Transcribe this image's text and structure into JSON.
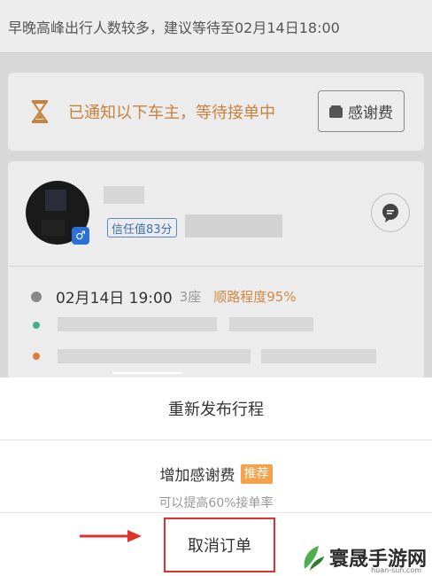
{
  "top_notice": {
    "text": "早晚高峰出行人数较多，建议等待至02月14日18:00"
  },
  "status_card": {
    "icon": "hourglass-icon",
    "text": "已通知以下车主，等待接单中",
    "thanks_button": "感谢费"
  },
  "driver": {
    "trust_score": "信任值83分",
    "gender_icon": "male-icon",
    "gender_symbol": "♂",
    "chat_icon": "chat-icon"
  },
  "trip": {
    "time": "02月14日 19:00",
    "seats": "3座",
    "match": "顺路程度95%"
  },
  "sheet": {
    "republish": "重新发布行程",
    "add_fee": "增加感谢费",
    "recommend_badge": "推荐",
    "add_fee_sub": "可以提高60%接单率",
    "cancel": "取消订单"
  },
  "watermark": {
    "text": "寰晟手游网",
    "url": "huan-sun.com"
  },
  "colors": {
    "accent_orange": "#c8823f",
    "highlight_red": "#e0322c",
    "badge_blue": "#2b6fd8"
  }
}
